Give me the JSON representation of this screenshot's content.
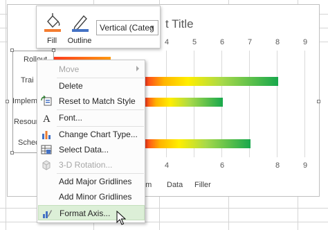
{
  "chart": {
    "title_visible": "t Title",
    "x_ticks_top": [
      "4",
      "5",
      "6",
      "7",
      "8",
      "9"
    ],
    "x_ticks_bottom": [
      "4",
      "6",
      "8",
      "9"
    ],
    "category_labels": [
      "Rollout",
      "Trai",
      "Impleme",
      "Resour",
      "Sched"
    ],
    "legend_items": [
      "um",
      "Data",
      "Filler"
    ]
  },
  "chart_data": {
    "type": "bar",
    "title": "t Title",
    "xlim": [
      0,
      9
    ],
    "categories": [
      "Rollout",
      "Trai",
      "Impleme",
      "Resour",
      "Sched"
    ],
    "values": [
      null,
      8,
      6,
      null,
      7
    ],
    "legend": [
      "um",
      "Data",
      "Filler"
    ]
  },
  "mini_toolbar": {
    "fill_label": "Fill",
    "outline_label": "Outline",
    "select_value": "Vertical (Categ"
  },
  "context_menu": {
    "items": [
      {
        "label": "Move",
        "disabled": true,
        "submenu": true,
        "icon": "none"
      },
      {
        "label": "Delete",
        "disabled": false,
        "icon": "none"
      },
      {
        "label": "Reset to Match Style",
        "disabled": false,
        "icon": "reset-style-icon"
      },
      {
        "label": "Font...",
        "disabled": false,
        "icon": "font-icon"
      },
      {
        "label": "Change Chart Type...",
        "disabled": false,
        "icon": "chart-type-icon"
      },
      {
        "label": "Select Data...",
        "disabled": false,
        "icon": "select-data-icon"
      },
      {
        "label": "3-D Rotation...",
        "disabled": true,
        "icon": "3d-rotation-icon"
      },
      {
        "label": "Add Major Gridlines",
        "disabled": false,
        "icon": "none"
      },
      {
        "label": "Add Minor Gridlines",
        "disabled": false,
        "icon": "none"
      },
      {
        "label": "Format Axis...",
        "disabled": false,
        "highlight": true,
        "icon": "format-axis-icon"
      }
    ]
  },
  "colors": {
    "fill_bar": "#f47d30",
    "outline_bar": "#4472c4",
    "highlight": "#dcefd7",
    "gradient_start": "#ff3c1e",
    "gradient_end": "#18a84c"
  }
}
